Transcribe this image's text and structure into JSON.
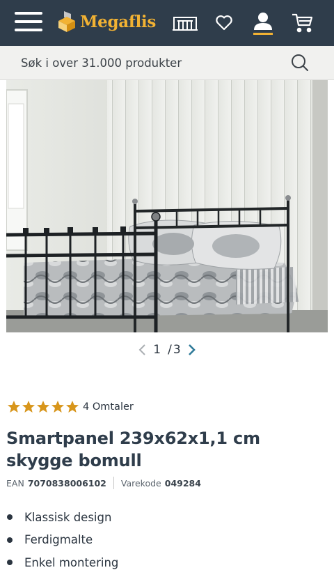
{
  "header": {
    "brand": "Megaflis",
    "icons": [
      "menu-icon",
      "showroom-icon",
      "heart-icon",
      "user-icon",
      "cart-icon"
    ],
    "colors": {
      "bar": "#2f3d4b",
      "accent": "#f2b233"
    }
  },
  "search": {
    "placeholder": "Søk i over 31.000 produkter"
  },
  "gallery": {
    "current": "1",
    "separator": "/",
    "total": "3"
  },
  "product": {
    "rating_stars": 5,
    "reviews": "4 Omtaler",
    "title": "Smartpanel 239x62x1,1 cm skygge bomull",
    "ean_label": "EAN",
    "ean": "7070838006102",
    "code_label": "Varekode",
    "code": "049284",
    "features": [
      "Klassisk design",
      "Ferdigmalte",
      "Enkel montering"
    ]
  }
}
